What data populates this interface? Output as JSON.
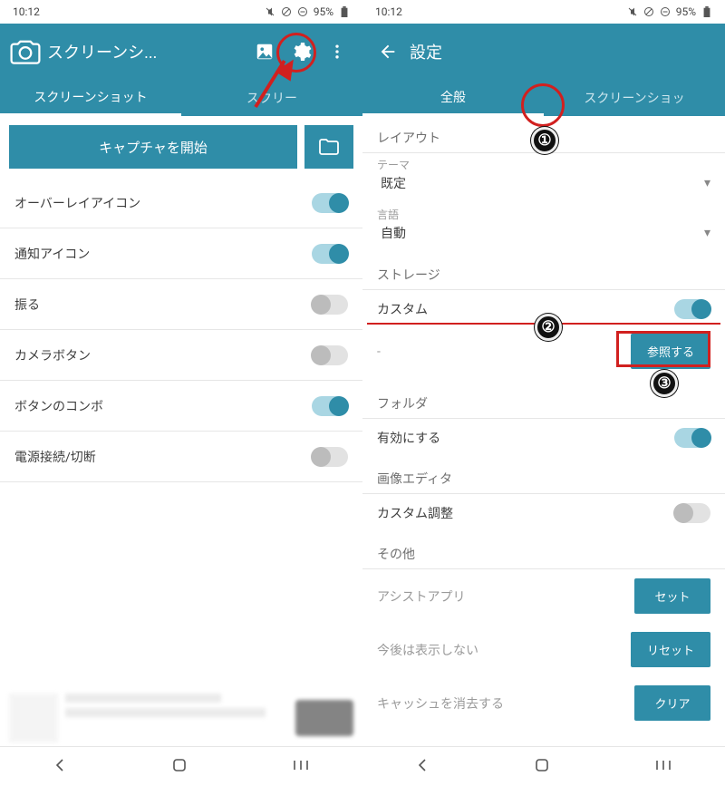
{
  "status": {
    "time": "10:12",
    "battery": "95%"
  },
  "left": {
    "appTitle": "スクリーンシ...",
    "tabs": {
      "t1": "スクリーンショット",
      "t2": "スクリー"
    },
    "captureBtn": "キャプチャを開始",
    "rows": {
      "overlay": "オーバーレイアイコン",
      "notif": "通知アイコン",
      "shake": "振る",
      "camera": "カメラボタン",
      "combo": "ボタンのコンボ",
      "power": "電源接続/切断"
    }
  },
  "right": {
    "appTitle": "設定",
    "tabs": {
      "t1": "全般",
      "t2": "スクリーンショッ"
    },
    "sections": {
      "layout": "レイアウト",
      "storage": "ストレージ",
      "folder": "フォルダ",
      "editor": "画像エディタ",
      "other": "その他"
    },
    "fields": {
      "themeLabel": "テーマ",
      "themeValue": "既定",
      "langLabel": "言語",
      "langValue": "自動",
      "custom": "カスタム",
      "dash": "-",
      "browse": "参照する",
      "enable": "有効にする",
      "customAdj": "カスタム調整",
      "assist": "アシストアプリ",
      "assistBtn": "セット",
      "noShow": "今後は表示しない",
      "noShowBtn": "リセット",
      "clearCache": "キャッシュを消去する",
      "clearBtn": "クリア"
    }
  }
}
